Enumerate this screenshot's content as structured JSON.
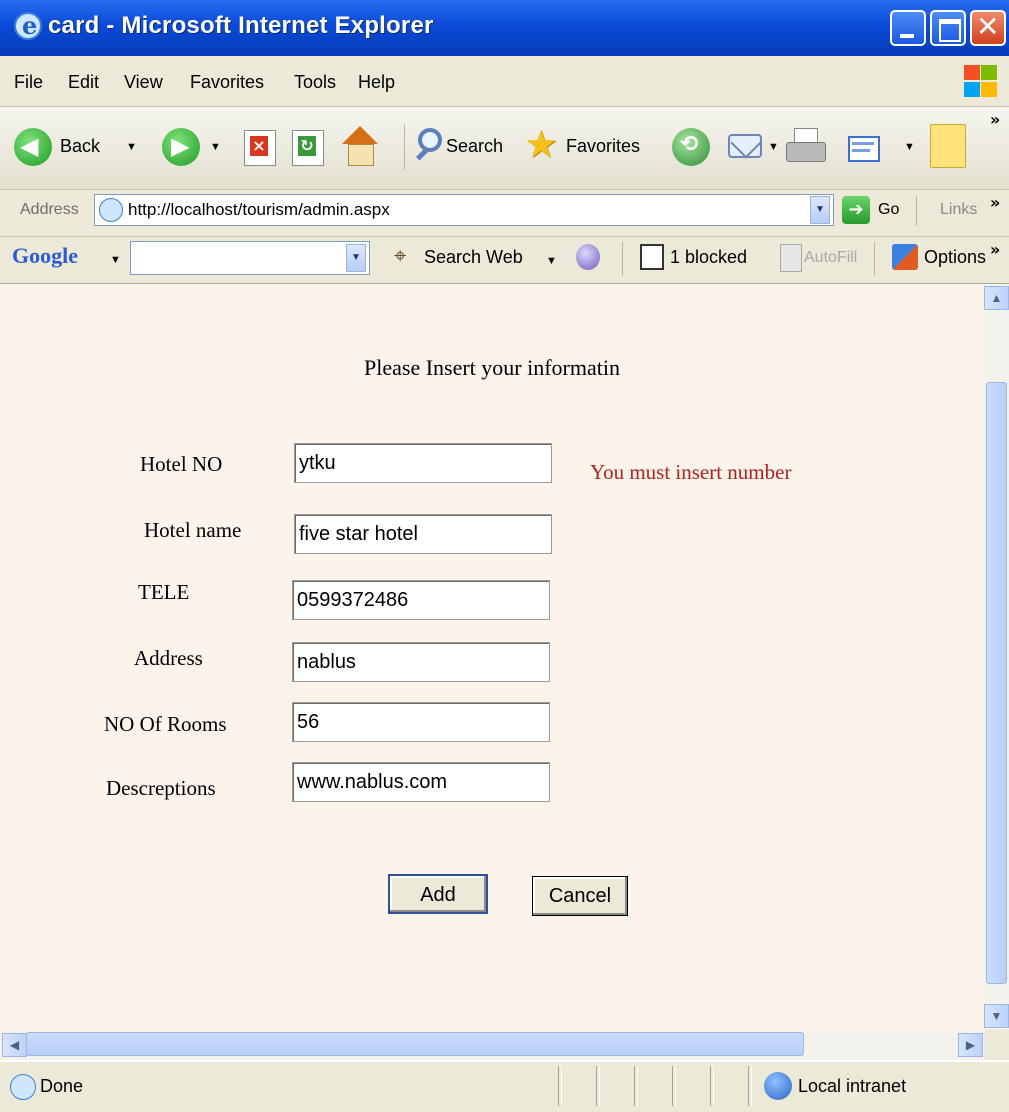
{
  "window": {
    "title": "card - Microsoft Internet Explorer"
  },
  "menu": [
    "File",
    "Edit",
    "View",
    "Favorites",
    "Tools",
    "Help"
  ],
  "toolbar": {
    "back_label": "Back",
    "search_label": "Search",
    "favorites_label": "Favorites",
    "chevron": "»"
  },
  "address": {
    "label": "Address",
    "url": "http://localhost/tourism/admin.aspx",
    "go_label": "Go",
    "links_label": "Links"
  },
  "googlebar": {
    "logo": "Google",
    "search_web_label": "Search Web",
    "blocked_label": "1 blocked",
    "autofill_label": "AutoFill",
    "options_label": "Options"
  },
  "form": {
    "heading": "Please Insert your informatin",
    "fields": [
      {
        "label": "Hotel NO",
        "value": "ytku"
      },
      {
        "label": "Hotel name",
        "value": "five star hotel"
      },
      {
        "label": "TELE",
        "value": "0599372486"
      },
      {
        "label": "Address",
        "value": "nablus"
      },
      {
        "label": "NO Of Rooms",
        "value": "56"
      },
      {
        "label": "Descreptions",
        "value": "www.nablus.com"
      }
    ],
    "error_message": "You must insert number",
    "add_label": "Add",
    "cancel_label": "Cancel"
  },
  "status": {
    "text": "Done",
    "zone": "Local intranet"
  },
  "colors": {
    "page_background": "#fcf3ea",
    "error_text": "#b32020",
    "titlebar_blue": "#0a4ad8"
  }
}
